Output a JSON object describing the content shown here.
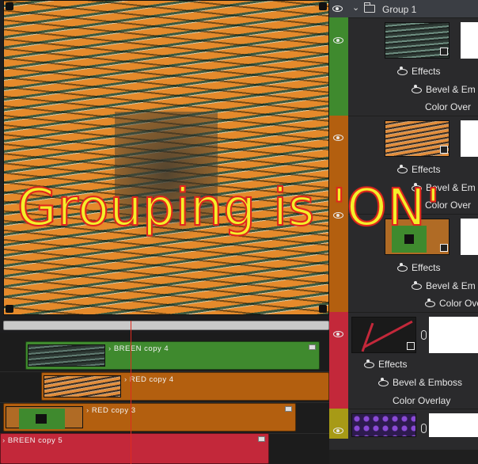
{
  "canvas": {
    "overlay_text": "Grouping is 'ON'"
  },
  "timeline": {
    "clips": [
      {
        "label": "BREEN copy 4"
      },
      {
        "label": "RED copy 4"
      },
      {
        "label": "RED copy 3"
      },
      {
        "label": "BREEN copy 5"
      }
    ]
  },
  "panel": {
    "group": {
      "label": "Group 1"
    },
    "layers": [
      {
        "effects": "Effects",
        "fx1": "Bevel & Em",
        "fx2": "Color Over"
      },
      {
        "effects": "Effects",
        "fx1": "Bevel & Em",
        "fx2": "Color Over"
      },
      {
        "effects": "Effects",
        "fx1": "Bevel & Em",
        "fx2": "Color Over"
      },
      {
        "effects": "Effects",
        "fx1": "Bevel & Emboss",
        "fx2": "Color Overlay"
      }
    ]
  },
  "colors": {
    "green": "#3f8a2e",
    "orange": "#b35f0f",
    "red": "#c3283a",
    "mustard": "#a79a16",
    "playhead": "#e02a1f",
    "overlay_fill": "#f4ef2a"
  },
  "icons": [
    "eye-icon",
    "folder-icon",
    "chevron-down-icon",
    "film-icon",
    "link-icon",
    "fx-icon"
  ]
}
